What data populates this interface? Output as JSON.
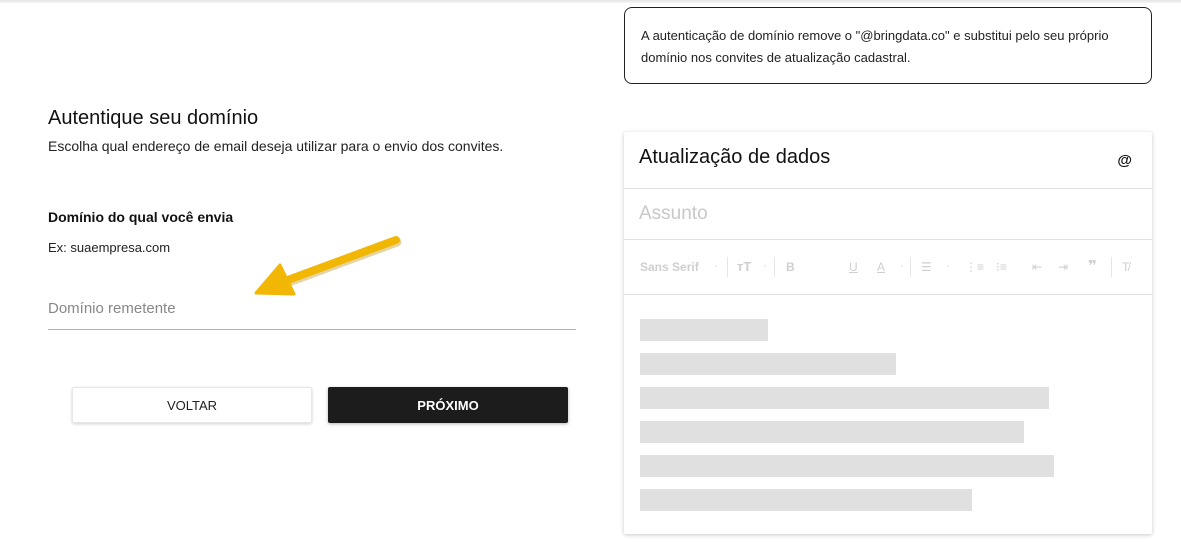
{
  "form": {
    "title": "Autentique seu domínio",
    "subtitle": "Escolha qual endereço de email deseja utilizar para o envio dos convites.",
    "field_label": "Domínio do qual você envia",
    "field_help": "Ex: suaempresa.com",
    "domain_input": {
      "placeholder": "Domínio remetente",
      "value": ""
    },
    "back_label": "VOLTAR",
    "next_label": "PRÓXIMO"
  },
  "info": {
    "text": "A autenticação de domínio remove o \"@bringdata.co\" e substitui pelo seu próprio domínio nos convites de atualização cadastral."
  },
  "preview": {
    "title": "Atualização de dados",
    "at_symbol": "@",
    "subject_placeholder": "Assunto",
    "toolbar": {
      "font_family": "Sans Serif",
      "items": [
        "font-family-select",
        "text-size-icon",
        "bold-icon",
        "underline-icon",
        "text-color-icon",
        "align-icon",
        "numbered-list-icon",
        "bullet-list-icon",
        "indent-decrease-icon",
        "indent-increase-icon",
        "quote-icon",
        "clear-format-icon"
      ]
    }
  },
  "colors": {
    "primary_button": "#1c1c1c",
    "arrow": "#f0b400",
    "placeholder_block": "#e0e0e0"
  }
}
